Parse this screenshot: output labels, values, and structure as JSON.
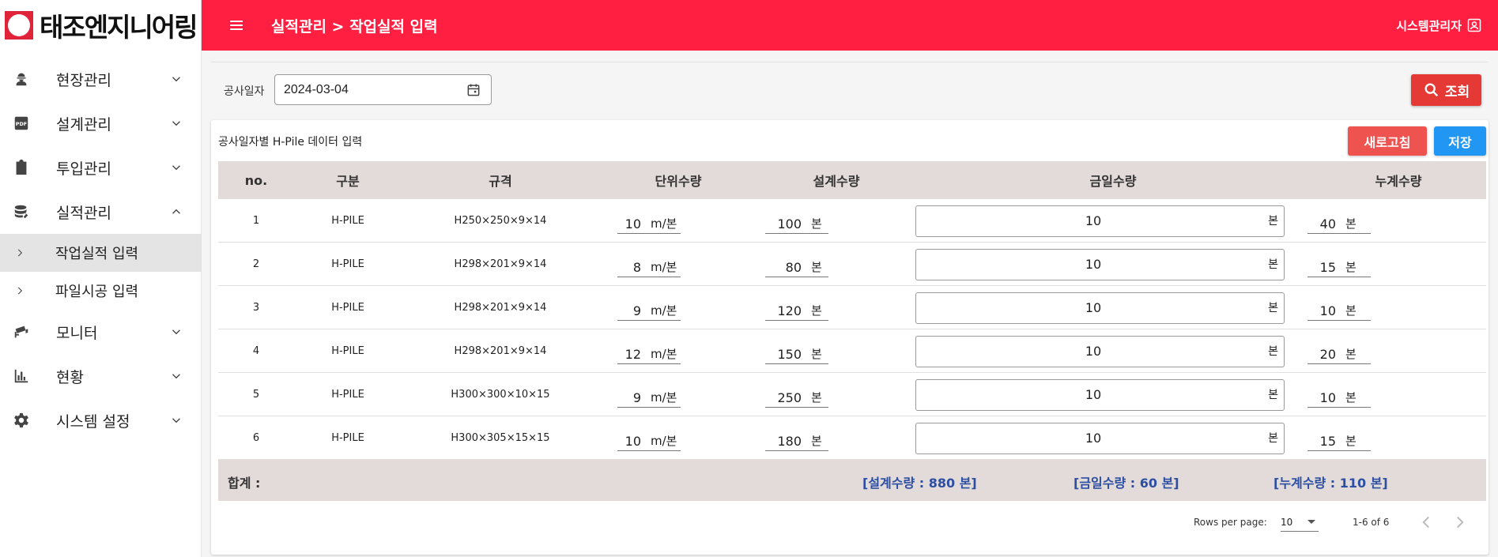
{
  "brand": {
    "name": "태조엔지니어링"
  },
  "header": {
    "breadcrumb": "실적관리 > 작업실적 입력",
    "user": "시스템관리자"
  },
  "sidebar": {
    "items": [
      {
        "label": "현장관리",
        "icon": "worker-icon",
        "expanded": false
      },
      {
        "label": "설계관리",
        "icon": "pdf-icon",
        "expanded": false
      },
      {
        "label": "투입관리",
        "icon": "clipboard-icon",
        "expanded": false
      },
      {
        "label": "실적관리",
        "icon": "database-icon",
        "expanded": true,
        "children": [
          {
            "label": "작업실적 입력",
            "active": true
          },
          {
            "label": "파일시공 입력",
            "active": false
          }
        ]
      },
      {
        "label": "모니터",
        "icon": "cctv-icon",
        "expanded": false
      },
      {
        "label": "현황",
        "icon": "bar-chart-icon",
        "expanded": false
      },
      {
        "label": "시스템 설정",
        "icon": "gear-icon",
        "expanded": false
      }
    ]
  },
  "filter": {
    "date_label": "공사일자",
    "date_value": "2024-03-04",
    "search_label": "조회"
  },
  "card": {
    "title": "공사일자별 H-Pile 데이터 입력",
    "refresh_label": "새로고침",
    "save_label": "저장"
  },
  "table": {
    "headers": {
      "no": "no.",
      "type": "구분",
      "spec": "규격",
      "unit": "단위수량",
      "design": "설계수량",
      "today": "금일수량",
      "cum": "누계수량"
    },
    "unit_m": "m/본",
    "unit_pc": "본",
    "rows": [
      {
        "no": "1",
        "type": "H-PILE",
        "spec": "H250×250×9×14",
        "unit": "10",
        "design": "100",
        "today": "10",
        "cum": "40"
      },
      {
        "no": "2",
        "type": "H-PILE",
        "spec": "H298×201×9×14",
        "unit": "8",
        "design": "80",
        "today": "10",
        "cum": "15"
      },
      {
        "no": "3",
        "type": "H-PILE",
        "spec": "H298×201×9×14",
        "unit": "9",
        "design": "120",
        "today": "10",
        "cum": "10"
      },
      {
        "no": "4",
        "type": "H-PILE",
        "spec": "H298×201×9×14",
        "unit": "12",
        "design": "150",
        "today": "10",
        "cum": "20"
      },
      {
        "no": "5",
        "type": "H-PILE",
        "spec": "H300×300×10×15",
        "unit": "9",
        "design": "250",
        "today": "10",
        "cum": "10"
      },
      {
        "no": "6",
        "type": "H-PILE",
        "spec": "H300×305×15×15",
        "unit": "10",
        "design": "180",
        "today": "10",
        "cum": "15"
      }
    ],
    "total": {
      "label": "합계 :",
      "design": "[설계수량 : 880 본]",
      "today": "[금일수량 : 60 본]",
      "cum": "[누계수량 : 110 본]"
    }
  },
  "pagination": {
    "rows_per_page_label": "Rows per page:",
    "rows_per_page": "10",
    "range": "1-6 of 6"
  },
  "colors": {
    "header_red": "#ff1f41",
    "search_red": "#e53935",
    "refresh_red": "#ef5350",
    "save_blue": "#2196f3",
    "total_blue": "#2c4ea3",
    "table_head_bg": "#e2dbd9"
  }
}
